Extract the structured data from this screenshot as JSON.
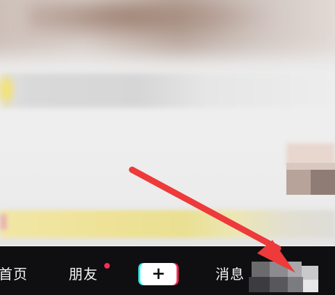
{
  "video": {
    "state": "blurred"
  },
  "bottom_nav": {
    "items": [
      {
        "label": "首页"
      },
      {
        "label": "朋友"
      },
      {
        "label": "+"
      },
      {
        "label": "消息"
      },
      {
        "label": ""
      }
    ],
    "friends_badge": "red-dot",
    "plus_icon": "plus-icon"
  },
  "annotation": {
    "type": "arrow",
    "color": "#ee3a3a",
    "points_to": "profile-tab"
  },
  "colors": {
    "nav_bg": "#0f0f12",
    "accent_pink": "#fe2c55",
    "accent_cyan": "#25f4ee"
  }
}
